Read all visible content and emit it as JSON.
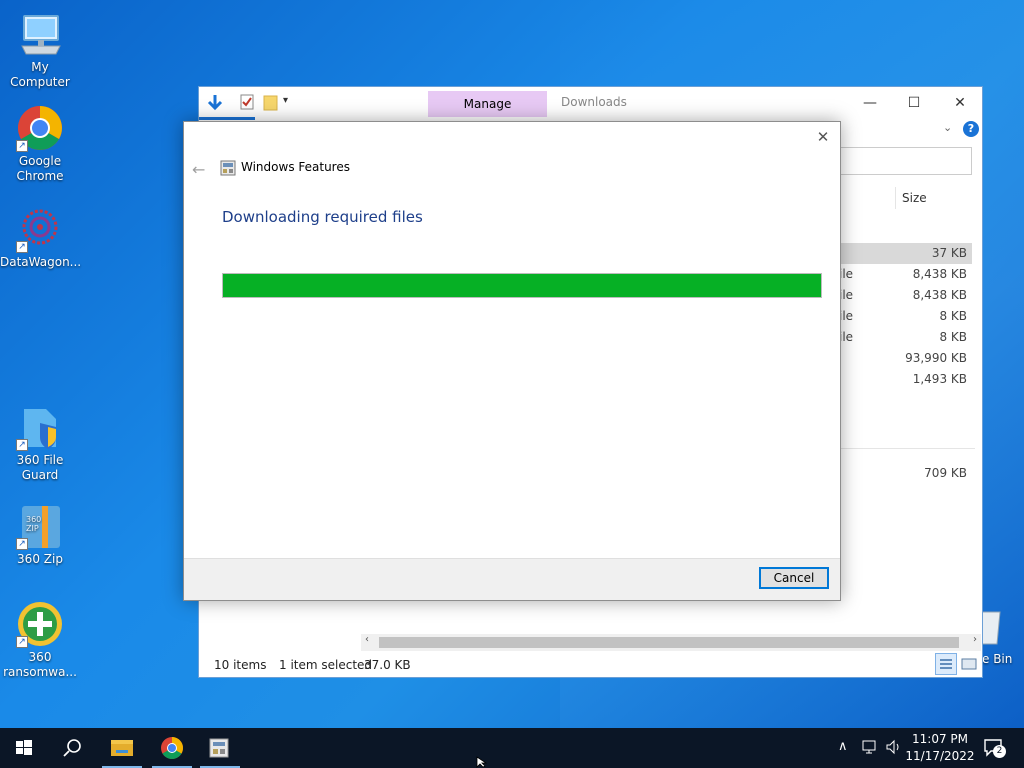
{
  "desktop": {
    "icons": [
      {
        "label": "My Computer"
      },
      {
        "label": "Google Chrome"
      },
      {
        "label": "DataWagon..."
      },
      {
        "label": "360 File Guard"
      },
      {
        "label": "360 Zip"
      },
      {
        "label": "360 ransomwa..."
      },
      {
        "label": "e Bin"
      }
    ]
  },
  "explorer": {
    "manage_tab": "Manage",
    "title": "Downloads",
    "column_size": "Size",
    "rows": [
      {
        "type": "",
        "size": "37 KB",
        "selected": true
      },
      {
        "type": "ile",
        "size": "8,438 KB"
      },
      {
        "type": "ile",
        "size": "8,438 KB"
      },
      {
        "type": "ile",
        "size": "8 KB"
      },
      {
        "type": "ile",
        "size": "8 KB"
      },
      {
        "type": "",
        "size": "93,990 KB"
      },
      {
        "type": "",
        "size": "1,493 KB"
      },
      {
        "type": "",
        "size": "709 KB"
      }
    ],
    "status": {
      "items": "10 items",
      "selected": "1 item selected",
      "selected_size": "37.0 KB"
    }
  },
  "dialog": {
    "title": "Windows Features",
    "heading": "Downloading required files",
    "progress_fraction": 1.0,
    "cancel_label": "Cancel"
  },
  "taskbar": {
    "time": "11:07 PM",
    "date": "11/17/2022",
    "notification_count": "2"
  },
  "colors": {
    "progress_fill": "#06b025",
    "heading": "#1e3f8a",
    "manage_tab": "#e7c9f4",
    "taskbar": "#0b1626"
  }
}
